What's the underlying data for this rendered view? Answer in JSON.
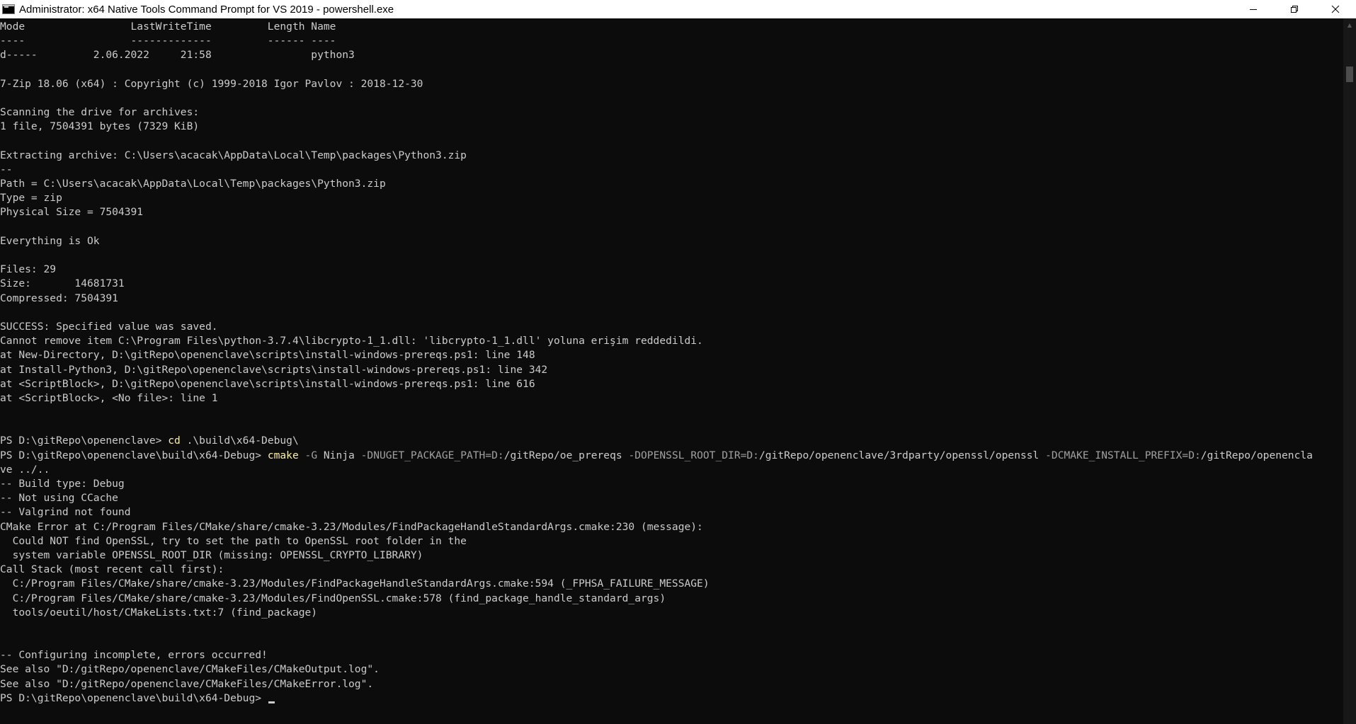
{
  "window": {
    "title": "Administrator: x64 Native Tools Command Prompt for VS 2019 - powershell.exe",
    "app_icon": "cmd-console-icon",
    "controls": [
      "minimize-icon",
      "restore-icon",
      "close-icon"
    ]
  },
  "terminal": {
    "lines": [
      [
        {
          "t": "Mode                 LastWriteTime         Length Name"
        }
      ],
      [
        {
          "t": "----                 -------------         ------ ----"
        }
      ],
      [
        {
          "t": "d-----         2.06.2022     21:58                python3"
        }
      ],
      [
        {
          "t": ""
        }
      ],
      [
        {
          "t": "7-Zip 18.06 (x64) : Copyright (c) 1999-2018 Igor Pavlov : 2018-12-30"
        }
      ],
      [
        {
          "t": ""
        }
      ],
      [
        {
          "t": "Scanning the drive for archives:"
        }
      ],
      [
        {
          "t": "1 file, 7504391 bytes (7329 KiB)"
        }
      ],
      [
        {
          "t": ""
        }
      ],
      [
        {
          "t": "Extracting archive: C:\\Users\\acacak\\AppData\\Local\\Temp\\packages\\Python3.zip"
        }
      ],
      [
        {
          "t": "--"
        }
      ],
      [
        {
          "t": "Path = C:\\Users\\acacak\\AppData\\Local\\Temp\\packages\\Python3.zip"
        }
      ],
      [
        {
          "t": "Type = zip"
        }
      ],
      [
        {
          "t": "Physical Size = 7504391"
        }
      ],
      [
        {
          "t": ""
        }
      ],
      [
        {
          "t": "Everything is Ok"
        }
      ],
      [
        {
          "t": ""
        }
      ],
      [
        {
          "t": "Files: 29"
        }
      ],
      [
        {
          "t": "Size:       14681731"
        }
      ],
      [
        {
          "t": "Compressed: 7504391"
        }
      ],
      [
        {
          "t": ""
        }
      ],
      [
        {
          "t": "SUCCESS: Specified value was saved."
        }
      ],
      [
        {
          "t": "Cannot remove item C:\\Program Files\\python-3.7.4\\libcrypto-1_1.dll: 'libcrypto-1_1.dll' yoluna erişim reddedildi."
        }
      ],
      [
        {
          "t": "at New-Directory, D:\\gitRepo\\openenclave\\scripts\\install-windows-prereqs.ps1: line 148"
        }
      ],
      [
        {
          "t": "at Install-Python3, D:\\gitRepo\\openenclave\\scripts\\install-windows-prereqs.ps1: line 342"
        }
      ],
      [
        {
          "t": "at <ScriptBlock>, D:\\gitRepo\\openenclave\\scripts\\install-windows-prereqs.ps1: line 616"
        }
      ],
      [
        {
          "t": "at <ScriptBlock>, <No file>: line 1"
        }
      ],
      [
        {
          "t": ""
        }
      ],
      [
        {
          "t": ""
        }
      ],
      [
        {
          "t": "PS D:\\gitRepo\\openenclave> "
        },
        {
          "t": "cd",
          "c": "yellow"
        },
        {
          "t": " .\\build\\x64-Debug\\"
        }
      ],
      [
        {
          "t": "PS D:\\gitRepo\\openenclave\\build\\x64-Debug> "
        },
        {
          "t": "cmake",
          "c": "yellow"
        },
        {
          "t": " -G",
          "c": "gray"
        },
        {
          "t": " Ninja "
        },
        {
          "t": "-DNUGET_PACKAGE_PATH=D:",
          "c": "gray"
        },
        {
          "t": "/gitRepo/oe_prereqs "
        },
        {
          "t": "-DOPENSSL_ROOT_DIR=D:",
          "c": "gray"
        },
        {
          "t": "/gitRepo/openenclave/3rdparty/openssl/openssl "
        },
        {
          "t": "-DCMAKE_INSTALL_PREFIX=D:",
          "c": "gray"
        },
        {
          "t": "/gitRepo/openencla"
        }
      ],
      [
        {
          "t": "ve ../.."
        }
      ],
      [
        {
          "t": "-- Build type: Debug"
        }
      ],
      [
        {
          "t": "-- Not using CCache"
        }
      ],
      [
        {
          "t": "-- Valgrind not found"
        }
      ],
      [
        {
          "t": "CMake Error at C:/Program Files/CMake/share/cmake-3.23/Modules/FindPackageHandleStandardArgs.cmake:230 (message):"
        }
      ],
      [
        {
          "t": "  Could NOT find OpenSSL, try to set the path to OpenSSL root folder in the"
        }
      ],
      [
        {
          "t": "  system variable OPENSSL_ROOT_DIR (missing: OPENSSL_CRYPTO_LIBRARY)"
        }
      ],
      [
        {
          "t": "Call Stack (most recent call first):"
        }
      ],
      [
        {
          "t": "  C:/Program Files/CMake/share/cmake-3.23/Modules/FindPackageHandleStandardArgs.cmake:594 (_FPHSA_FAILURE_MESSAGE)"
        }
      ],
      [
        {
          "t": "  C:/Program Files/CMake/share/cmake-3.23/Modules/FindOpenSSL.cmake:578 (find_package_handle_standard_args)"
        }
      ],
      [
        {
          "t": "  tools/oeutil/host/CMakeLists.txt:7 (find_package)"
        }
      ],
      [
        {
          "t": ""
        }
      ],
      [
        {
          "t": ""
        }
      ],
      [
        {
          "t": "-- Configuring incomplete, errors occurred!"
        }
      ],
      [
        {
          "t": "See also \"D:/gitRepo/openenclave/CMakeFiles/CMakeOutput.log\"."
        }
      ],
      [
        {
          "t": "See also \"D:/gitRepo/openenclave/CMakeFiles/CMakeError.log\"."
        }
      ],
      [
        {
          "t": "PS D:\\gitRepo\\openenclave\\build\\x64-Debug> "
        }
      ]
    ]
  },
  "colors": {
    "background": "#0c0c0c",
    "foreground": "#cccccc",
    "command": "#f9f1a5",
    "parameter": "#a0a0a0"
  },
  "scrollbar": {
    "up_icon": "scroll-up-arrow-icon",
    "down_icon": "scroll-down-arrow-icon"
  }
}
